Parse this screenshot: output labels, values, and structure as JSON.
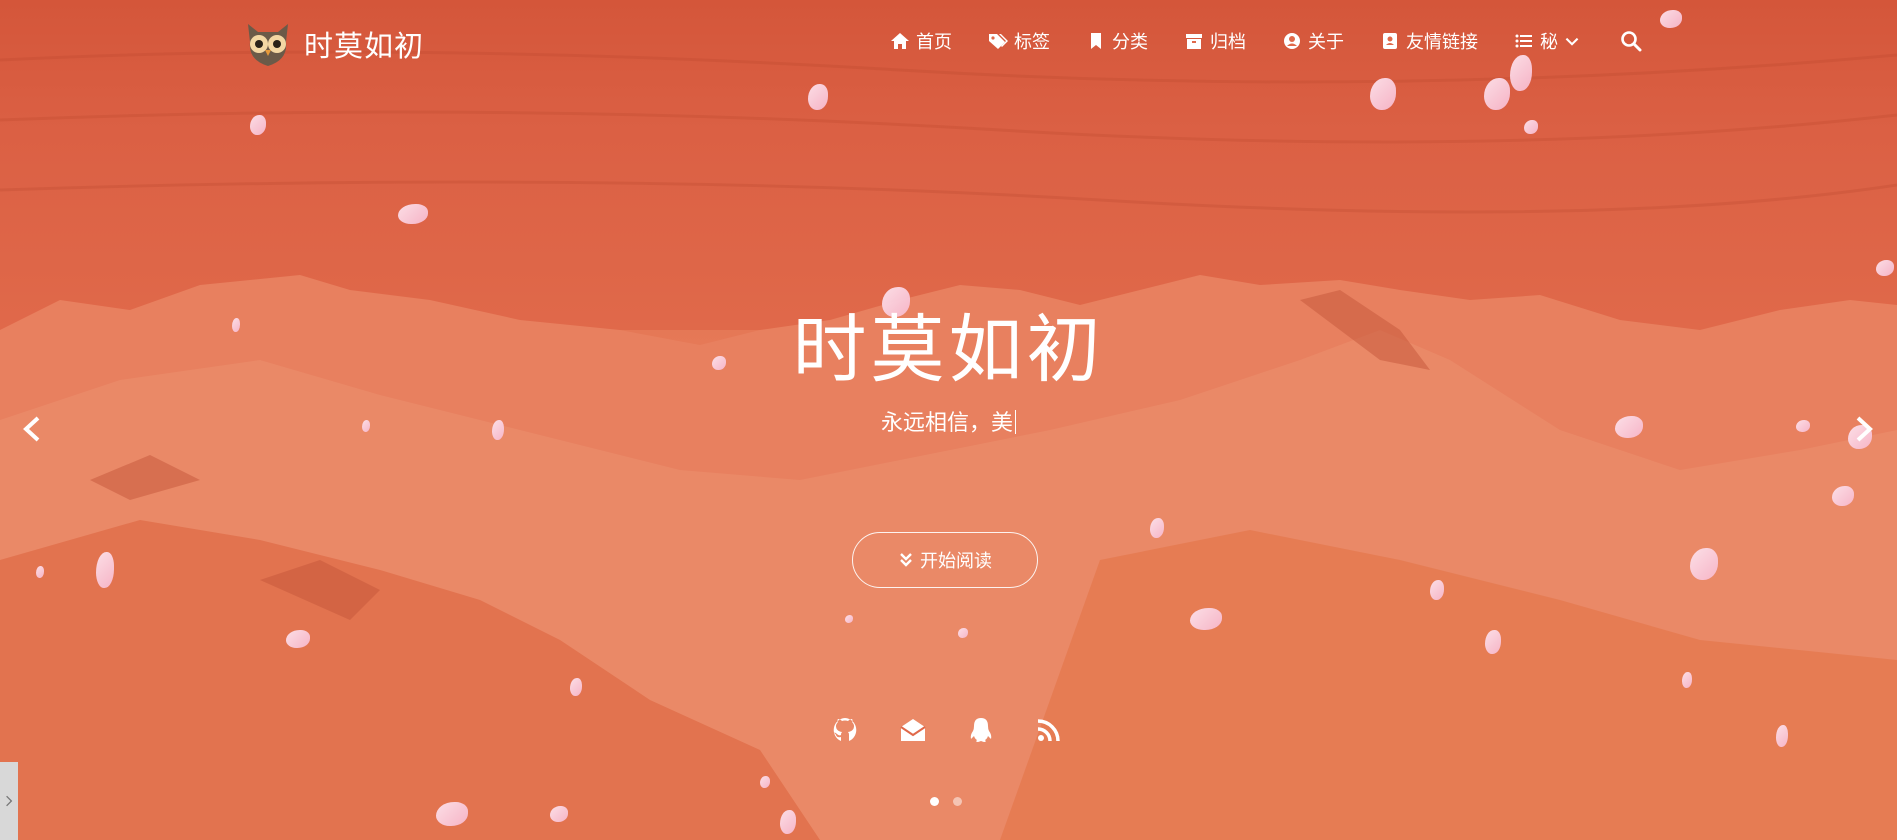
{
  "brand": {
    "title": "时莫如初",
    "logo_icon": "owl-logo-icon"
  },
  "nav": {
    "items": [
      {
        "label": "首页",
        "icon": "home-icon"
      },
      {
        "label": "标签",
        "icon": "tags-icon"
      },
      {
        "label": "分类",
        "icon": "bookmark-icon"
      },
      {
        "label": "归档",
        "icon": "archive-icon"
      },
      {
        "label": "关于",
        "icon": "user-circle-icon"
      },
      {
        "label": "友情链接",
        "icon": "address-book-icon"
      },
      {
        "label": "秘",
        "icon": "list-icon",
        "has_dropdown": true
      }
    ],
    "search_icon": "search-icon"
  },
  "hero": {
    "title": "时莫如初",
    "subtitle": "永远相信，美",
    "read_button": "开始阅读",
    "read_icon": "double-chevron-down-icon"
  },
  "socials": [
    "github-icon",
    "mail-open-icon",
    "qq-icon",
    "rss-icon"
  ],
  "carousel": {
    "slides": 2,
    "active": 1
  },
  "colors": {
    "overlay": "#e2714f",
    "text": "#ffffff"
  }
}
